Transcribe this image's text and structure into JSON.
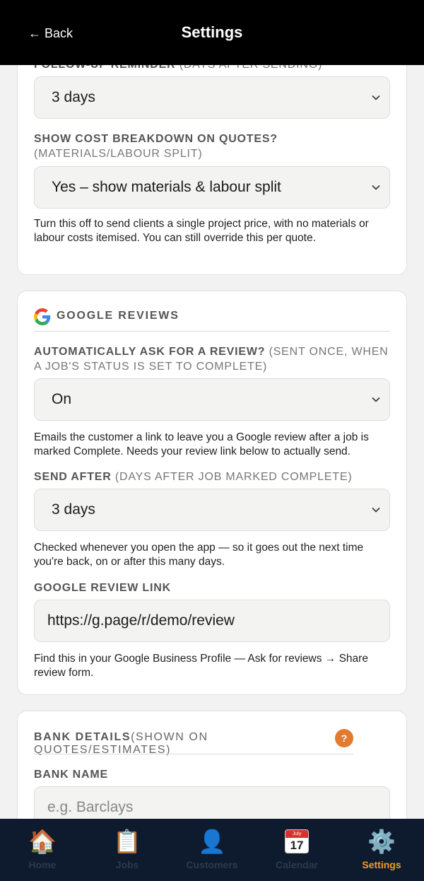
{
  "header": {
    "back_label": "← Back",
    "title": "Settings"
  },
  "quotes_card": {
    "followup_label": "FOLLOW-UP REMINDER",
    "followup_sub": " (DAYS AFTER SENDING)",
    "followup_value": "3 days",
    "breakdown_label": "SHOW COST BREAKDOWN ON QUOTES?",
    "breakdown_sub": "(MATERIALS/LABOUR SPLIT)",
    "breakdown_value": "Yes – show materials & labour split",
    "breakdown_help": "Turn this off to send clients a single project price, with no materials or labour costs itemised. You can still override this per quote."
  },
  "reviews_card": {
    "section_title": "GOOGLE REVIEWS",
    "auto_label": "AUTOMATICALLY ASK FOR A REVIEW?",
    "auto_sub": " (SENT ONCE, WHEN A JOB'S STATUS IS SET TO COMPLETE)",
    "auto_value": "On",
    "auto_help": "Emails the customer a link to leave you a Google review after a job is marked Complete. Needs your review link below to actually send.",
    "send_after_label": "SEND AFTER",
    "send_after_sub": " (DAYS AFTER JOB MARKED COMPLETE)",
    "send_after_value": "3 days",
    "send_after_help": "Checked whenever you open the app — so it goes out the next time you're back, on or after this many days.",
    "link_label": "GOOGLE REVIEW LINK",
    "link_value": "https://g.page/r/demo/review",
    "link_help": "Find this in your Google Business Profile — Ask for reviews → Share review form."
  },
  "bank_card": {
    "section_title": "BANK DETAILS",
    "section_sub": "(SHOWN ON QUOTES/ESTIMATES)",
    "help_badge": "?",
    "bank_name_label": "BANK NAME",
    "bank_name_placeholder": "e.g. Barclays"
  },
  "nav": {
    "items": [
      {
        "label": "Home",
        "icon": "🏠"
      },
      {
        "label": "Jobs",
        "icon": "📋"
      },
      {
        "label": "Customers",
        "icon": "👤"
      },
      {
        "label": "Calendar",
        "icon": "calendar-icon",
        "cal_month": "July",
        "cal_day": "17"
      },
      {
        "label": "Settings",
        "icon": "⚙️"
      }
    ],
    "active_color": "#f0a020"
  }
}
